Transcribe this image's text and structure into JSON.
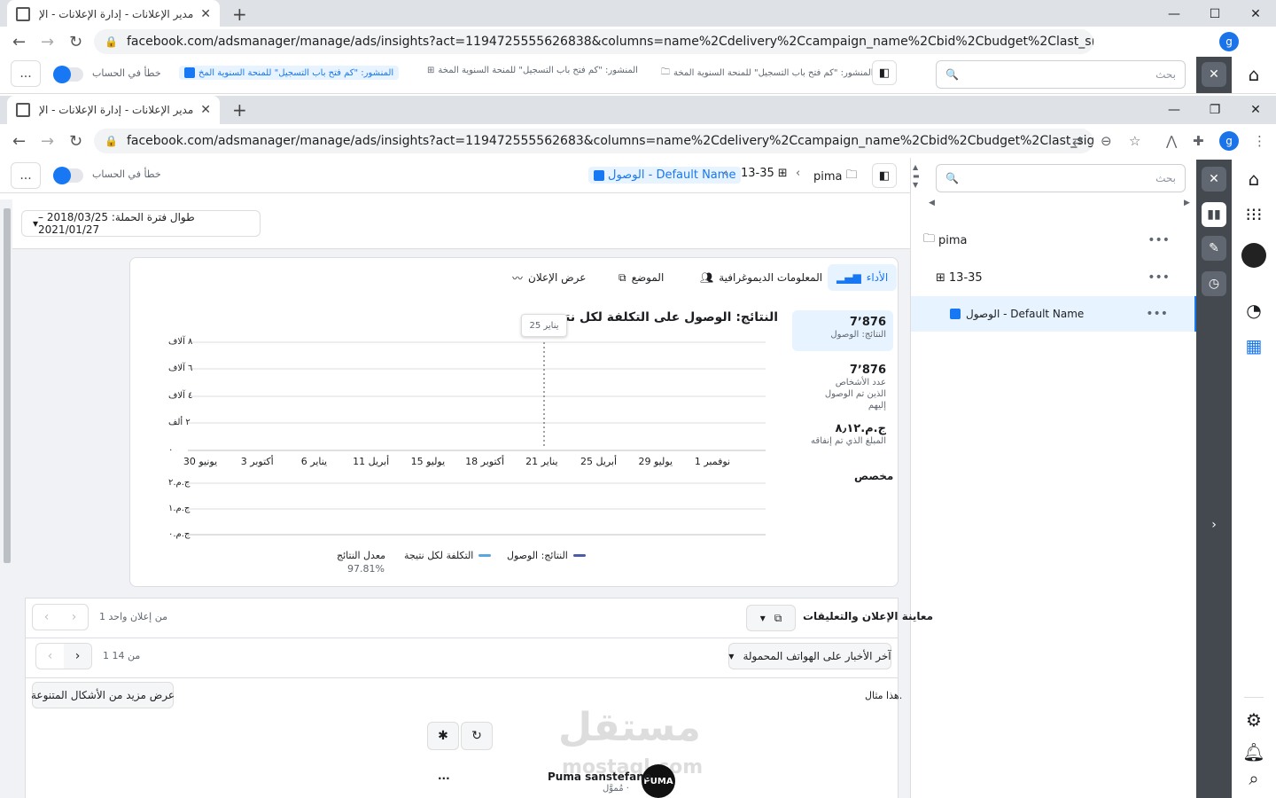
{
  "window_back": {
    "tab_title": "مدير الإعلانات - إدارة الإعلانات - الإ",
    "url": "facebook.com/adsmanager/manage/ads/insights?act=1194725555626838&columns=name%2Cdelivery%2Ccampaign_name%2Cbid%2Cbudget%2Clast_significant_edit%...",
    "breadcrumb_1": "المنشور: \"كم فتح باب التسجيل\" للمنحة السنوية المخ",
    "breadcrumb_2": "المنشور: \"كم فتح باب التسجيل\" للمنحة السنوية المخة",
    "breadcrumb_3": "المنشور: \"كم فتح باب التسجيل\" للمنحة السنوية المخة",
    "toggle_label": "خطأ في الحساب",
    "search_placeholder": "بحث"
  },
  "browser": {
    "tab_title": "مدير الإعلانات - إدارة الإعلانات - الإ",
    "url": "facebook.com/adsmanager/manage/ads/insights?act=119472555562683&columns=name%2Cdelivery%2Ccampaign_name%2Cbid%2Cbudget%2Clast_significant_edit%...",
    "profile_initial": "g"
  },
  "toolbar": {
    "more": "...",
    "toggle_label": "خطأ في الحساب",
    "crumb_campaign": "pima",
    "crumb_adset": "13-35",
    "crumb_ad": "الوصول - Default Name"
  },
  "sidebar": {
    "search_placeholder": "بحث",
    "items": [
      {
        "label": "pima"
      },
      {
        "label": "13-35"
      },
      {
        "label": "الوصول - Default Name"
      }
    ]
  },
  "main": {
    "date_range": "طوال فترة الحملة: 2018/03/25 – 2021/01/27",
    "tabs": [
      {
        "label": "الأداء"
      },
      {
        "label": "المعلومات الديموغرافية"
      },
      {
        "label": "الموضع"
      },
      {
        "label": "عرض الإعلان"
      }
    ],
    "metrics": [
      {
        "value": "7٬876",
        "label": "النتائج: الوصول"
      },
      {
        "value": "7٬876",
        "label": "عدد الأشخاص الذين تم الوصول إليهم"
      },
      {
        "value": "ج.م.٨٫١٢",
        "label": "المبلغ الذي تم إنفاقه"
      }
    ],
    "custom_label": "مخصص",
    "chart_title": "النتائج: الوصول على التكلفة لكل نتيجة",
    "tooltip": "25 يناير",
    "result_rate_label": "معدل النتائج",
    "result_rate_value": "97.81%"
  },
  "chart_data": {
    "type": "line",
    "title": "النتائج: الوصول على التكلفة لكل نتيجة",
    "x_ticks": [
      "30 يونيو",
      "3 أكتوبر",
      "6 يناير",
      "11 أبريل",
      "15 يوليو",
      "18 أكتوبر",
      "21 يناير",
      "25 أبريل",
      "29 يوليو",
      "1 نوفمبر"
    ],
    "y_ticks_top": [
      "٠",
      "٢ ألف",
      "٤ آلاف",
      "٦ آلاف",
      "٨ آلاف"
    ],
    "y_ticks_bottom": [
      "ج.م.٠",
      "ج.م.١",
      "ج.م.٢"
    ],
    "series": [
      {
        "name": "النتائج: الوصول",
        "color": "#4a5ea8"
      },
      {
        "name": "التكلفة لكل نتيجة",
        "color": "#5aa6e0"
      }
    ],
    "grid": true
  },
  "preview": {
    "title": "معاينة الإعلان والتعليقات",
    "count": "1 من إعلان واحد",
    "placement": "آخر الأخبار على الهواتف المحمولة",
    "page_count": "1 من 14",
    "example": "هذا مثال.",
    "more_formats": "عرض مزيد من الأشكال المتنوعة",
    "page_name": "Puma sanstefano",
    "sponsored": "مُموَّل ·",
    "logo": "PUMA",
    "more": "..."
  },
  "watermark": {
    "text": "مستقل",
    "sub": "mostaql.com"
  }
}
